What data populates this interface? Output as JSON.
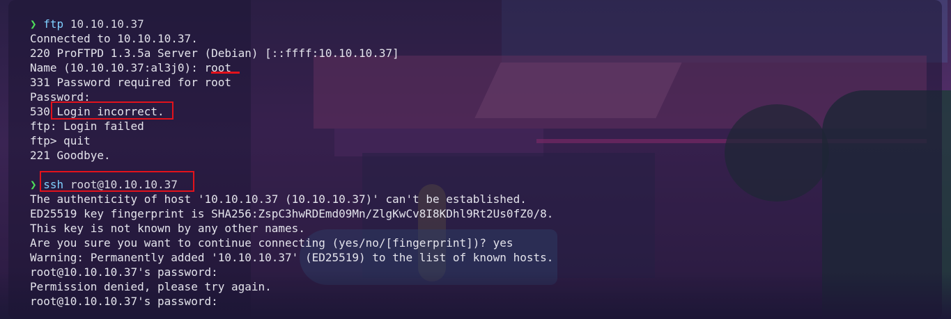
{
  "terminal": {
    "lines": [
      {
        "prompt": "❯",
        "cmd": "ftp",
        "arg": " 10.10.10.37"
      },
      {
        "text": "Connected to 10.10.10.37."
      },
      {
        "text": "220 ProFTPD 1.3.5a Server (Debian) [::ffff:10.10.10.37]"
      },
      {
        "text": "Name (10.10.10.37:al3j0): root"
      },
      {
        "text": "331 Password required for root"
      },
      {
        "text": "Password:"
      },
      {
        "text": "530 Login incorrect."
      },
      {
        "text": "ftp: Login failed"
      },
      {
        "text": "ftp> quit"
      },
      {
        "text": "221 Goodbye."
      },
      {
        "text": ""
      },
      {
        "prompt": "❯",
        "cmd": "ssh",
        "arg": " root@10.10.10.37"
      },
      {
        "text": "The authenticity of host '10.10.10.37 (10.10.10.37)' can't be established."
      },
      {
        "text": "ED25519 key fingerprint is SHA256:ZspC3hwRDEmd09Mn/ZlgKwCv8I8KDhl9Rt2Us0fZ0/8."
      },
      {
        "text": "This key is not known by any other names."
      },
      {
        "text": "Are you sure you want to continue connecting (yes/no/[fingerprint])? yes"
      },
      {
        "text": "Warning: Permanently added '10.10.10.37' (ED25519) to the list of known hosts."
      },
      {
        "text": "root@10.10.10.37's password:"
      },
      {
        "text": "Permission denied, please try again."
      },
      {
        "text": "root@10.10.10.37's password:"
      }
    ]
  },
  "annotations": {
    "color": "#e3121b",
    "underline": "root",
    "boxes": [
      "Login incorrect.",
      "ssh root@10.10.10.37"
    ]
  },
  "colors": {
    "prompt": "#4ee05a",
    "command": "#7fd0ff",
    "text": "#e4e4ec"
  }
}
